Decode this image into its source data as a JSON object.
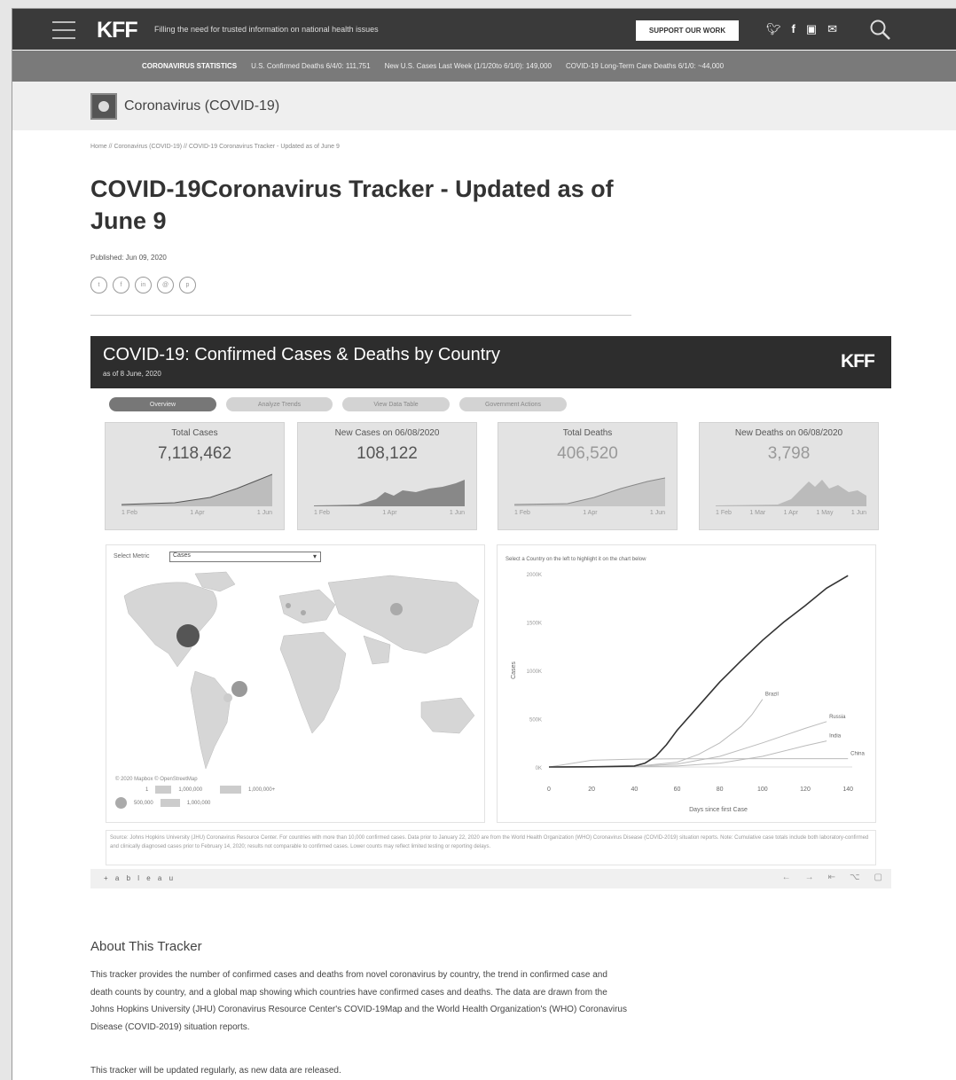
{
  "header": {
    "logo": "KFF",
    "tagline": "Filling the need for trusted information on national health issues",
    "support_label": "SUPPORT OUR WORK",
    "social": [
      "twitter",
      "facebook",
      "instagram",
      "email"
    ]
  },
  "stats_bar": {
    "label": "CORONAVIRUS STATISTICS",
    "items": [
      "U.S. Confirmed Deaths 6/4/0: 111,751",
      "New U.S. Cases Last Week (1/1/20to 6/1/0): 149,000",
      "COVID-19 Long-Term Care Deaths 6/1/0: ~44,000"
    ]
  },
  "section": {
    "title": "Coronavirus (COVID-19)"
  },
  "breadcrumb": "Home // Coronavirus (COVID-19) // COVID-19 Coronavirus Tracker - Updated as of June 9",
  "page": {
    "title": "COVID-19Coronavirus Tracker - Updated as of June 9",
    "published": "Published: Jun 09, 2020"
  },
  "dashboard": {
    "title": "COVID-19: Confirmed Cases & Deaths by Country",
    "subtitle": "as of 8 June, 2020",
    "logo": "KFF",
    "tabs": [
      "Overview",
      "Analyze Trends",
      "View Data Table",
      "Government Actions"
    ],
    "kpis": [
      {
        "label": "Total Cases",
        "value": "7,118,462",
        "ticks": [
          "1 Feb",
          "1 Apr",
          "1 Jun"
        ]
      },
      {
        "label": "New Cases on 06/08/2020",
        "value": "108,122",
        "ticks": [
          "1 Feb",
          "1 Apr",
          "1 Jun"
        ]
      },
      {
        "label": "Total Deaths",
        "value": "406,520",
        "ticks": [
          "1 Feb",
          "1 Apr",
          "1 Jun"
        ]
      },
      {
        "label": "New Deaths on 06/08/2020",
        "value": "3,798",
        "ticks": [
          "1 Feb",
          "1 Mar",
          "1 Apr",
          "1 May",
          "1 Jun"
        ]
      }
    ],
    "map": {
      "select_label": "Select Metric",
      "select_value": "Cases",
      "note": "© 2020 Mapbox © OpenStreetMap",
      "legend": [
        "1",
        "1,000,000",
        "1,000,000+",
        "500,000",
        "1,000,000"
      ]
    },
    "chart_hint": "Select a Country on the left to highlight it on the chart below",
    "footnote": "Source: Johns Hopkins University (JHU) Coronavirus Resource Center. For countries with more than 10,000 confirmed cases. Data prior to January 22, 2020 are from the World Health Organization (WHO) Coronavirus Disease (COVID-2019) situation reports. Note: Cumulative case totals include both laboratory-confirmed and clinically diagnosed cases prior to February 14, 2020; results not comparable to confirmed cases. Lower counts may reflect limited testing or reporting delays.",
    "tableau_label": "+ a b l e a u"
  },
  "chart_data": {
    "type": "line",
    "title": "",
    "xlabel": "Days since first Case",
    "ylabel": "Cases",
    "x_ticks": [
      0,
      20,
      40,
      60,
      80,
      100,
      120,
      140
    ],
    "y_ticks": [
      "0K",
      "500K",
      "1000K",
      "1500K",
      "2000K"
    ],
    "xlim": [
      0,
      142
    ],
    "ylim": [
      0,
      2000
    ],
    "grid": false,
    "series": [
      {
        "name": "",
        "color": "#333333",
        "x": [
          0,
          20,
          40,
          45,
          50,
          55,
          60,
          70,
          80,
          90,
          100,
          110,
          120,
          130,
          140
        ],
        "y": [
          0,
          2,
          10,
          40,
          110,
          230,
          380,
          630,
          880,
          1100,
          1310,
          1500,
          1670,
          1850,
          1980
        ]
      },
      {
        "name": "Brazil",
        "color": "#bbbbbb",
        "x": [
          0,
          40,
          60,
          70,
          80,
          90,
          95,
          100
        ],
        "y": [
          0,
          5,
          50,
          130,
          250,
          420,
          540,
          700
        ]
      },
      {
        "name": "Russia",
        "color": "#bbbbbb",
        "x": [
          0,
          40,
          60,
          80,
          100,
          120,
          130
        ],
        "y": [
          0,
          5,
          30,
          110,
          250,
          400,
          470
        ]
      },
      {
        "name": "India",
        "color": "#bbbbbb",
        "x": [
          0,
          40,
          60,
          80,
          100,
          120,
          130
        ],
        "y": [
          0,
          3,
          10,
          40,
          110,
          220,
          270
        ]
      },
      {
        "name": "China",
        "color": "#bbbbbb",
        "x": [
          0,
          20,
          40,
          60,
          80,
          100,
          120,
          140
        ],
        "y": [
          0,
          70,
          82,
          84,
          85,
          86,
          86,
          86
        ]
      }
    ]
  }
}
